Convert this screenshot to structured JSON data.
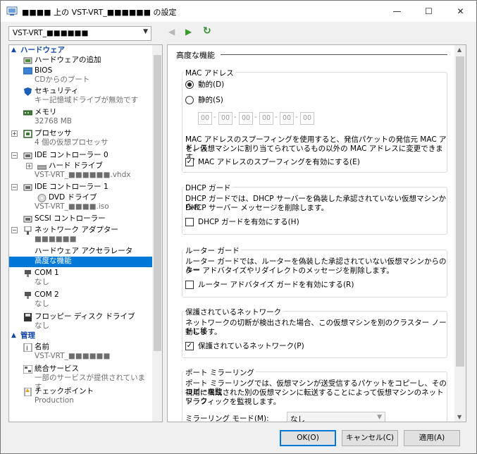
{
  "window": {
    "title": "■■■■ 上の VST-VRT_■■■■■■ の設定",
    "min": "—",
    "max": "☐",
    "close": "✕"
  },
  "toolbar": {
    "vm_selected": "VST-VRT_■■■■■■",
    "dropdown_arrow": "▼",
    "back": "◀",
    "forward": "▶",
    "refresh": "↻"
  },
  "tree": {
    "hardware_section": "ハードウェア",
    "management_section": "管理",
    "chevron": "▲",
    "items": [
      {
        "label": "ハードウェアの追加",
        "sub": ""
      },
      {
        "label": "BIOS",
        "sub": "CDからのブート"
      },
      {
        "label": "セキュリティ",
        "sub": "キー記憶域ドライブが無効です"
      },
      {
        "label": "メモリ",
        "sub": "32768 MB"
      },
      {
        "label": "プロセッサ",
        "sub": "4 個の仮想プロセッサ"
      },
      {
        "label": "IDE コントローラー 0",
        "sub": ""
      },
      {
        "label": "ハード ドライブ",
        "sub": "VST-VRT_■■■■■■.vhdx"
      },
      {
        "label": "IDE コントローラー 1",
        "sub": ""
      },
      {
        "label": "DVD ドライブ",
        "sub": "VST-VRT_■■■■.iso"
      },
      {
        "label": "SCSI コントローラー",
        "sub": ""
      },
      {
        "label": "ネットワーク アダプター",
        "sub": "■■■■■■"
      },
      {
        "label": "ハードウェア アクセラレータ",
        "sub": ""
      },
      {
        "label": "高度な機能",
        "sub": ""
      },
      {
        "label": "COM 1",
        "sub": "なし"
      },
      {
        "label": "COM 2",
        "sub": "なし"
      },
      {
        "label": "フロッピー ディスク ドライブ",
        "sub": "なし"
      },
      {
        "label": "名前",
        "sub": "VST-VRT_■■■■■■"
      },
      {
        "label": "統合サービス",
        "sub": "一部のサービスが提供されています"
      },
      {
        "label": "チェックポイント",
        "sub": "Production"
      }
    ],
    "expanders": {
      "plus": "+",
      "minus": "−"
    }
  },
  "panel": {
    "title": "高度な機能",
    "mac": {
      "label": "MAC アドレス",
      "dynamic": "動的(D)",
      "static": "静的(S)",
      "octets": [
        "00",
        "00",
        "00",
        "00",
        "00",
        "00"
      ],
      "desc": [
        "MAC アドレスのスプーフィングを使用すると、発信パケットの発信元 MAC アドレス",
        "を、仮想マシンに割り当てられているもの以外の MAC アドレスに変更できます。"
      ],
      "spoof": "MAC アドレスのスプーフィングを有効にする(E)"
    },
    "dhcp": {
      "label": "DHCP ガード",
      "desc": [
        "DHCP ガードでは、DHCP サーバーを偽装した承認されていない仮想マシンからの",
        "DHCP サーバー メッセージを削除します。"
      ],
      "cb": "DHCP ガードを有効にする(H)"
    },
    "router": {
      "label": "ルーター ガード",
      "desc": [
        "ルーター ガードでは、ルーターを偽装した承認されていない仮想マシンからのルー",
        "ター アドバタイズやリダイレクトのメッセージを削除します。"
      ],
      "cb": "ルーター アドバタイズ ガードを有効にする(R)"
    },
    "protected": {
      "label": "保護されているネットワーク",
      "desc": [
        "ネットワークの切断が検出された場合、この仮想マシンを別のクラスター ノードに移",
        "動します。"
      ],
      "cb": "保護されているネットワーク(P)"
    },
    "mirror": {
      "label": "ポート ミラーリング",
      "desc": [
        "ポート ミラーリングでは、仮想マシンが送受信するパケットをコピーし、そのコピーを監",
        "視用に構成された別の仮想マシンに転送することによって仮想マシンのネットワーク",
        "トラフィックを監視します。"
      ],
      "mode_label": "ミラーリング モード(M):",
      "mode_value": "なし"
    },
    "check": "✓",
    "dash": "-",
    "arrow_up": "▲",
    "arrow_down": "▼"
  },
  "buttons": {
    "ok": "OK(O)",
    "cancel": "キャンセル(C)",
    "apply": "適用(A)"
  }
}
